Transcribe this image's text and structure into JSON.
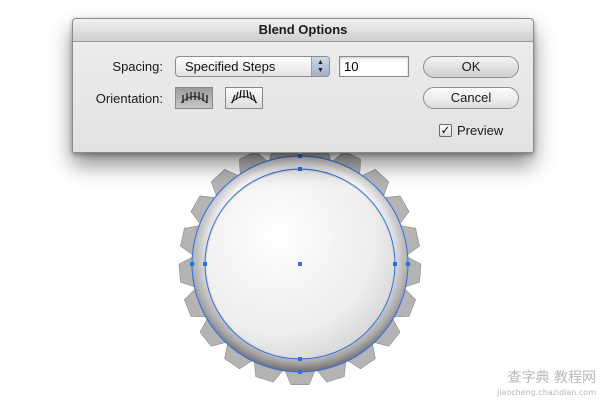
{
  "dialog": {
    "title": "Blend Options",
    "spacing_label": "Spacing:",
    "spacing_value": "Specified Steps",
    "steps_value": "10",
    "orientation_label": "Orientation:",
    "ok_label": "OK",
    "cancel_label": "Cancel",
    "preview_label": "Preview",
    "preview_checked": true
  },
  "watermark": {
    "text": "查字典 教程网",
    "url": "jiaocheng.chazidian.com"
  },
  "colors": {
    "path_blue": "#2f6fe8",
    "cap_silver": "#b9b9b9",
    "dialog_bg": "#e6e6e6"
  }
}
